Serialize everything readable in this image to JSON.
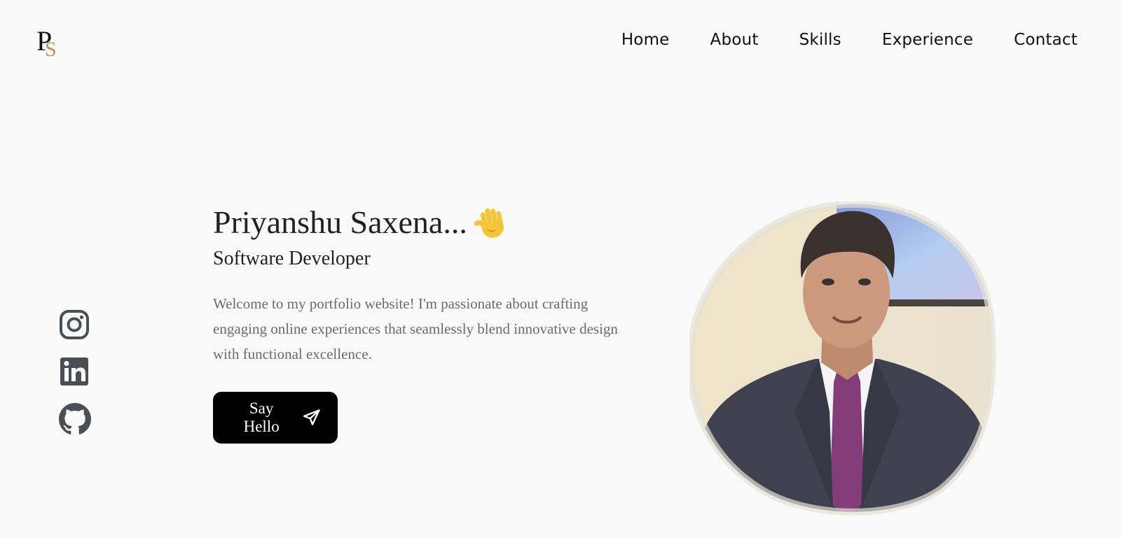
{
  "header": {
    "logo_text": "PS",
    "nav": [
      "Home",
      "About",
      "Skills",
      "Experience",
      "Contact"
    ]
  },
  "social": [
    {
      "icon": "instagram-icon"
    },
    {
      "icon": "linkedin-icon"
    },
    {
      "icon": "github-icon"
    }
  ],
  "hero": {
    "name": "Priyanshu Saxena...",
    "wave_icon": "waving-hand-icon",
    "subtitle": "Software Developer",
    "description": "Welcome to my portfolio website! I'm passionate about crafting engaging online experiences that seamlessly blend innovative design with functional excellence.",
    "cta_label": "Say Hello",
    "cta_icon": "paper-plane-icon"
  },
  "colors": {
    "background": "#f9f9f9",
    "text": "#222222",
    "muted": "#6b6b6b",
    "icon": "#4a4e55",
    "button": "#000000",
    "logo_gold": "#b8974f"
  }
}
